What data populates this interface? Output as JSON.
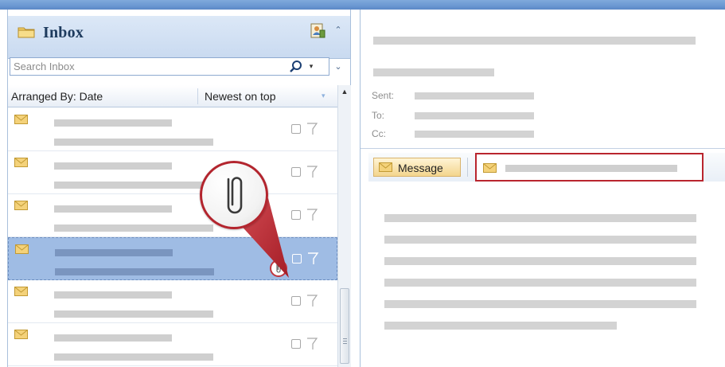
{
  "inbox": {
    "title": "Inbox",
    "folder_icon": "folder-icon",
    "contacts_icon": "address-book-icon",
    "collapse_glyph": "≈",
    "expand_glyph": "≈"
  },
  "search": {
    "placeholder": "Search Inbox",
    "value": "",
    "icon": "search-icon",
    "dropdown_glyph": "▾"
  },
  "arrange": {
    "label": "Arranged By: Date",
    "order": "Newest on top",
    "order_glyph": "▾"
  },
  "messages": [
    {
      "selected": false,
      "attachment": false,
      "icon": "envelope-icon"
    },
    {
      "selected": false,
      "attachment": false,
      "icon": "envelope-icon"
    },
    {
      "selected": false,
      "attachment": false,
      "icon": "envelope-icon"
    },
    {
      "selected": true,
      "attachment": true,
      "icon": "envelope-icon"
    },
    {
      "selected": false,
      "attachment": false,
      "icon": "envelope-icon"
    },
    {
      "selected": false,
      "attachment": false,
      "icon": "envelope-icon"
    }
  ],
  "reading_pane": {
    "sent_label": "Sent:",
    "to_label": "To:",
    "cc_label": "Cc:",
    "message_tab_label": "Message"
  },
  "colors": {
    "accent_blue": "#6b98d2",
    "selection": "#9fbce4",
    "highlight_red": "#b9252e"
  }
}
